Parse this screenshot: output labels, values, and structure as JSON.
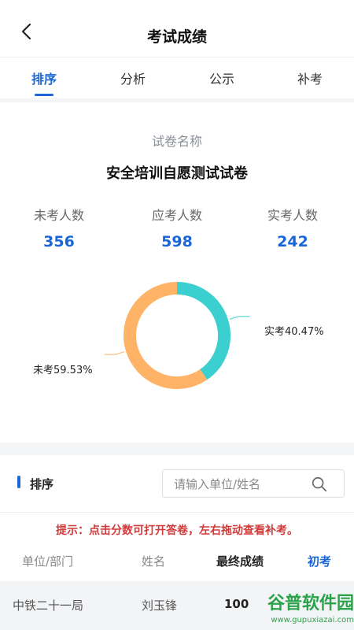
{
  "header": {
    "title": "考试成绩",
    "back_icon": "back-arrow-icon"
  },
  "tabs": [
    {
      "label": "排序",
      "active": true
    },
    {
      "label": "分析",
      "active": false
    },
    {
      "label": "公示",
      "active": false
    },
    {
      "label": "补考",
      "active": false
    }
  ],
  "summary": {
    "paper_label": "试卷名称",
    "paper_name": "安全培训自愿测试试卷",
    "stats": [
      {
        "label": "未考人数",
        "value": "356"
      },
      {
        "label": "应考人数",
        "value": "598"
      },
      {
        "label": "实考人数",
        "value": "242"
      }
    ]
  },
  "chart_data": {
    "type": "pie",
    "categories": [
      "实考",
      "未考"
    ],
    "values": [
      40.47,
      59.53
    ],
    "labels": [
      "实考40.47%",
      "未考59.53%"
    ],
    "colors": [
      "#3ccfcf",
      "#ffb366"
    ]
  },
  "ranking": {
    "section_title": "排序",
    "search_placeholder": "请输入单位/姓名",
    "hint": "提示：点击分数可打开答卷，左右拖动查看补考。",
    "columns": [
      "单位/部门",
      "姓名",
      "最终成绩",
      "初考"
    ],
    "rows": [
      {
        "unit": "中铁二十一局",
        "name": "刘玉锋",
        "score": "100"
      }
    ]
  },
  "watermark": {
    "text": "谷普软件园",
    "url": "www.gupuxiazai.com"
  }
}
